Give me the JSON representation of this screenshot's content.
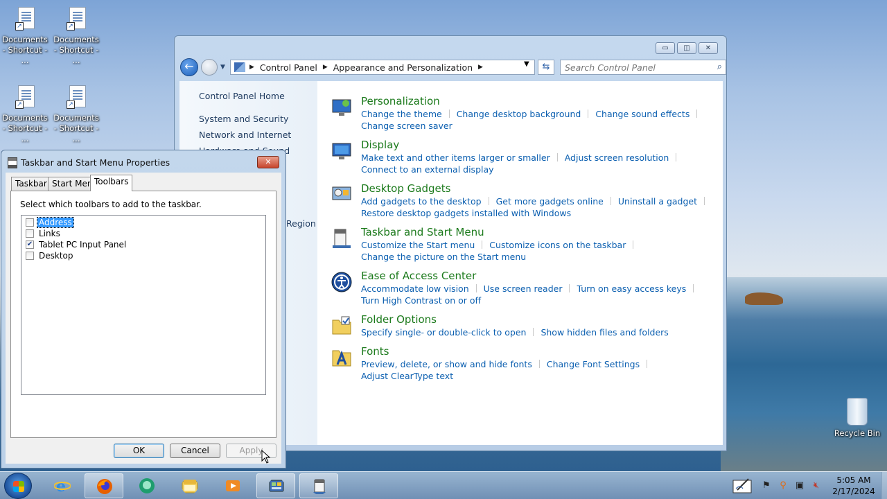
{
  "desktop": {
    "icons": [
      {
        "label": "Documents - Shortcut - ..."
      },
      {
        "label": "Documents - Shortcut - ..."
      },
      {
        "label": "Documents - Shortcut - ..."
      },
      {
        "label": "Documents - Shortcut - ..."
      }
    ],
    "recycle_bin": "Recycle Bin"
  },
  "control_panel": {
    "breadcrumb": [
      "Control Panel",
      "Appearance and Personalization"
    ],
    "search_placeholder": "Search Control Panel",
    "sidebar": {
      "home": "Control Panel Home",
      "items": [
        "System and Security",
        "Network and Internet",
        "Hardware and Sound",
        "Region"
      ]
    },
    "categories": [
      {
        "title": "Personalization",
        "links": [
          "Change the theme",
          "Change desktop background",
          "Change sound effects",
          "Change screen saver"
        ]
      },
      {
        "title": "Display",
        "links": [
          "Make text and other items larger or smaller",
          "Adjust screen resolution",
          "Connect to an external display"
        ]
      },
      {
        "title": "Desktop Gadgets",
        "links": [
          "Add gadgets to the desktop",
          "Get more gadgets online",
          "Uninstall a gadget",
          "Restore desktop gadgets installed with Windows"
        ]
      },
      {
        "title": "Taskbar and Start Menu",
        "links": [
          "Customize the Start menu",
          "Customize icons on the taskbar",
          "Change the picture on the Start menu"
        ]
      },
      {
        "title": "Ease of Access Center",
        "links": [
          "Accommodate low vision",
          "Use screen reader",
          "Turn on easy access keys",
          "Turn High Contrast on or off"
        ]
      },
      {
        "title": "Folder Options",
        "links": [
          "Specify single- or double-click to open",
          "Show hidden files and folders"
        ]
      },
      {
        "title": "Fonts",
        "links": [
          "Preview, delete, or show and hide fonts",
          "Change Font Settings",
          "Adjust ClearType text"
        ]
      }
    ]
  },
  "dialog": {
    "title": "Taskbar and Start Menu Properties",
    "tabs": [
      "Taskbar",
      "Start Menu",
      "Toolbars"
    ],
    "active_tab": "Toolbars",
    "description": "Select which toolbars to add to the taskbar.",
    "toolbars": [
      {
        "label": "Address",
        "checked": false,
        "selected": true
      },
      {
        "label": "Links",
        "checked": false,
        "selected": false
      },
      {
        "label": "Tablet PC Input Panel",
        "checked": true,
        "selected": false
      },
      {
        "label": "Desktop",
        "checked": false,
        "selected": false
      }
    ],
    "buttons": {
      "ok": "OK",
      "cancel": "Cancel",
      "apply": "Apply"
    }
  },
  "taskbar": {
    "clock_time": "5:05 AM",
    "clock_date": "2/17/2024"
  }
}
